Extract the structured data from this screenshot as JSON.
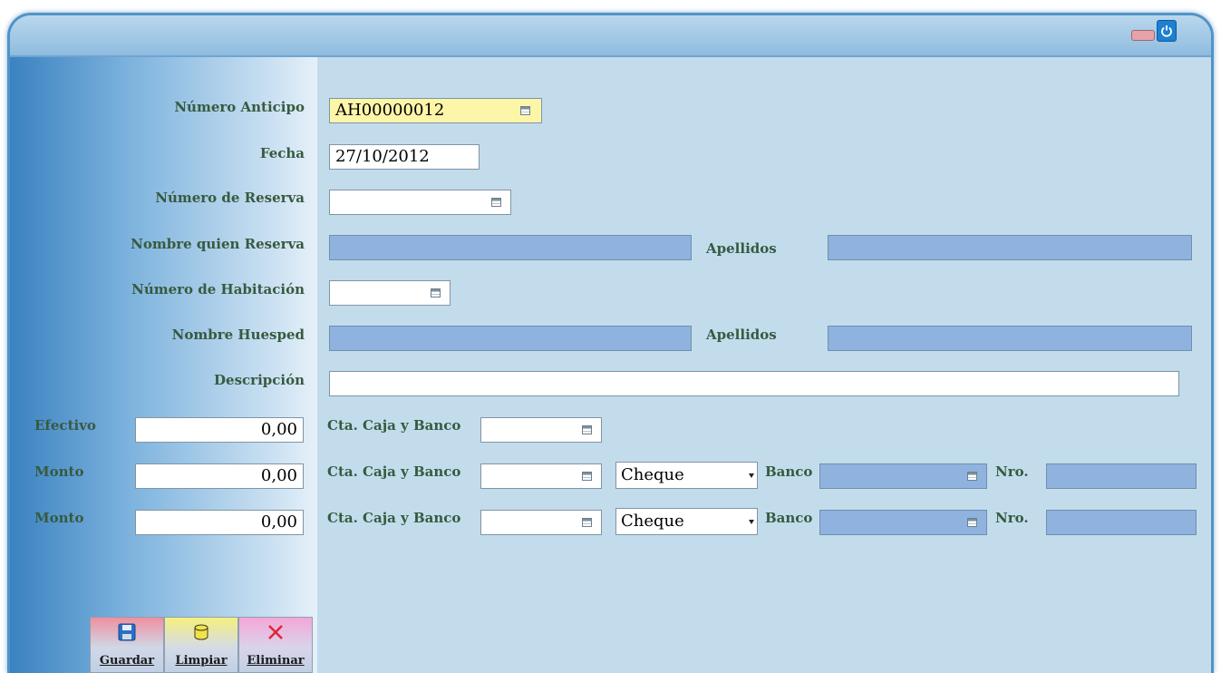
{
  "window": {
    "icons": {
      "minimize": "minimize-icon",
      "power": "power-icon"
    }
  },
  "form": {
    "numero_anticipo": {
      "label": "Número Anticipo",
      "value": "AH00000012"
    },
    "fecha": {
      "label": "Fecha",
      "value": "27/10/2012"
    },
    "numero_reserva": {
      "label": "Número de Reserva",
      "value": ""
    },
    "nombre_reserva": {
      "label": "Nombre quien Reserva",
      "value": ""
    },
    "apellidos_reserva": {
      "label": "Apellidos",
      "value": ""
    },
    "numero_habitacion": {
      "label": "Número de Habitación",
      "value": ""
    },
    "nombre_huesped": {
      "label": "Nombre Huesped",
      "value": ""
    },
    "apellidos_huesped": {
      "label": "Apellidos",
      "value": ""
    },
    "descripcion": {
      "label": "Descripción",
      "value": ""
    }
  },
  "payments": {
    "efectivo": {
      "label": "Efectivo",
      "amount": "0,00",
      "cta_label": "Cta. Caja y Banco",
      "cta_value": ""
    },
    "monto1": {
      "label": "Monto",
      "amount": "0,00",
      "cta_label": "Cta. Caja y Banco",
      "cta_value": "",
      "type": "Cheque",
      "banco_label": "Banco",
      "banco_value": "",
      "nro_label": "Nro.",
      "nro_value": ""
    },
    "monto2": {
      "label": "Monto",
      "amount": "0,00",
      "cta_label": "Cta. Caja y Banco",
      "cta_value": "",
      "type": "Cheque",
      "banco_label": "Banco",
      "banco_value": "",
      "nro_label": "Nro.",
      "nro_value": ""
    }
  },
  "toolbar": {
    "guardar": {
      "label": "Guardar",
      "icon": "save-icon"
    },
    "limpiar": {
      "label": "Limpiar",
      "icon": "database-icon"
    },
    "eliminar": {
      "label": "Eliminar",
      "icon": "delete-icon"
    }
  },
  "colors": {
    "label_text": "#375a3f",
    "highlight_field": "#fdf5a8",
    "readonly_field": "#8fb3de",
    "background": "#c3dcec"
  }
}
